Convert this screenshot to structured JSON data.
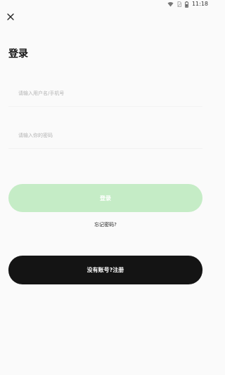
{
  "status_bar": {
    "time": "11:18",
    "icons": [
      "wifi-icon",
      "sim-card-icon",
      "battery-icon"
    ]
  },
  "header": {
    "close_icon": "close-icon",
    "title": "登录"
  },
  "form": {
    "username_placeholder": "请输入用户名/手机号",
    "username_value": "",
    "password_placeholder": "请输入你的密码",
    "password_value": ""
  },
  "actions": {
    "login_label": "登录",
    "forgot_label": "忘记密码?",
    "register_label": "没有账号?注册"
  },
  "colors": {
    "background": "#fafafa",
    "login_button": "#c5ecc6",
    "register_button": "#141414"
  }
}
